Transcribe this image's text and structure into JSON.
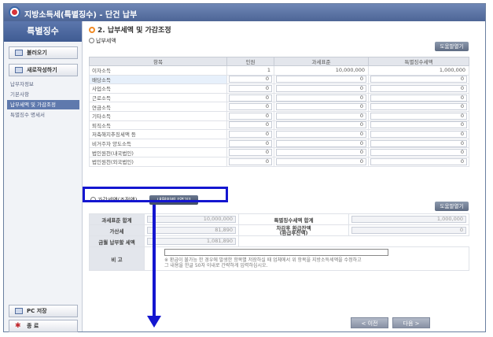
{
  "window": {
    "title": "지방소득세(특별징수) - 단건 납부"
  },
  "sidebar": {
    "header": "특별징수",
    "load_button": "불러오기",
    "new_button": "새로작성하기",
    "items": [
      {
        "label": "납부자정보"
      },
      {
        "label": "기본사항"
      },
      {
        "label": "납부세액 및 가감조정"
      },
      {
        "label": "특별징수 명세서"
      }
    ],
    "pc_save_button": "PC 저장",
    "exit_button": "종 료"
  },
  "main": {
    "section_title": "2. 납부세액 및 가감조정",
    "tax_section": {
      "label": "납부세액",
      "help_button": "도움말열기",
      "columns": [
        "항목",
        "인원",
        "과세표준",
        "특별징수세액"
      ],
      "rows": [
        {
          "item": "이자소득",
          "count": "1",
          "base": "10,000,000",
          "tax": "1,000,000"
        },
        {
          "item": "배당소득",
          "count": "0",
          "base": "0",
          "tax": "0"
        },
        {
          "item": "사업소득",
          "count": "0",
          "base": "0",
          "tax": "0"
        },
        {
          "item": "근로소득",
          "count": "0",
          "base": "0",
          "tax": "0"
        },
        {
          "item": "연금소득",
          "count": "0",
          "base": "0",
          "tax": "0"
        },
        {
          "item": "기타소득",
          "count": "0",
          "base": "0",
          "tax": "0"
        },
        {
          "item": "퇴직소득",
          "count": "0",
          "base": "0",
          "tax": "0"
        },
        {
          "item": "저축해지추징세액 등",
          "count": "0",
          "base": "0",
          "tax": "0"
        },
        {
          "item": "비거주자 양도소득",
          "count": "0",
          "base": "0",
          "tax": "0"
        },
        {
          "item": "법인원천(내국법인)",
          "count": "0",
          "base": "0",
          "tax": "0"
        },
        {
          "item": "법인원천(외국법인)",
          "count": "0",
          "base": "0",
          "tax": "0"
        }
      ]
    },
    "adjust_section": {
      "label": "가감세액(조정액)",
      "open_button": "내역입력 [열기]",
      "help_button": "도움말열기",
      "base_total_label": "과세표준 합계",
      "base_total_value": "10,000,000",
      "tax_total_label": "특별징수세액 합계",
      "tax_total_value": "1,000,000",
      "penalty_label": "가산세",
      "penalty_value": "81,890",
      "refund_label": "차감후 환급잔액",
      "refund_label_sub": "(환급후잔액)",
      "refund_value": "0",
      "pay_label": "금월 납부할 세액",
      "pay_value": "1,081,890",
      "remark_label": "비 고",
      "note_line1": "※ 환급이 불가능 한 경우에 발생한 항목별 저장하실 때 업체에서 위 항목을 지방소득세액을 수정하고",
      "note_line2": "그 내용을 한글 50자 이내로 간략하게 입력하십시오."
    },
    "prev_button": "< 이전",
    "next_button": "다음 >"
  }
}
